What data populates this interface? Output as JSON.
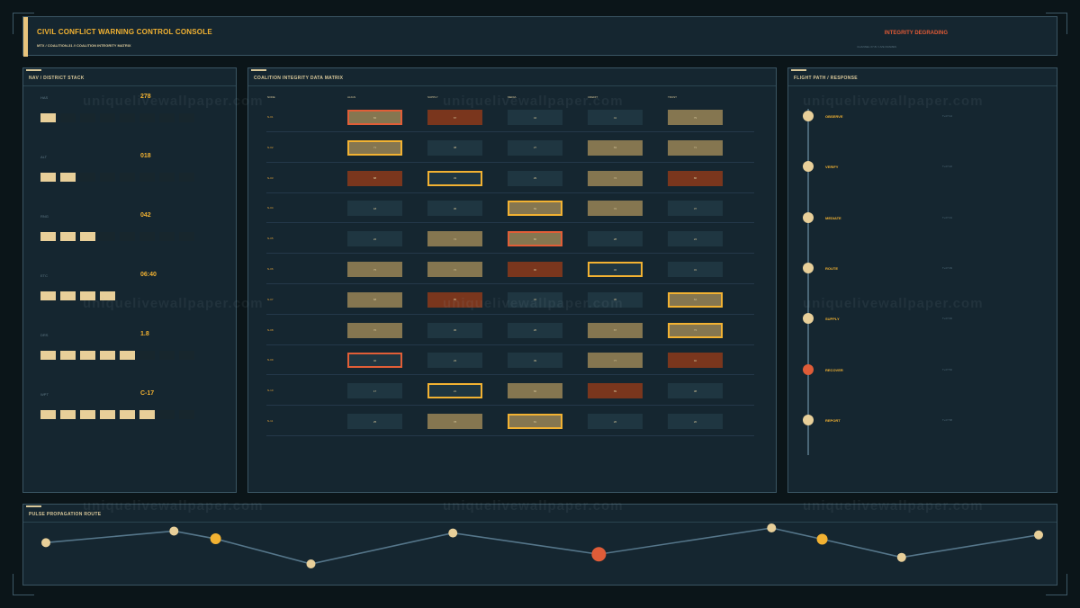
{
  "header": {
    "title": "CIVIL CONFLICT WARNING CONTROL CONSOLE",
    "breadcrumb": "MTX / COALITION-31 // COALITION INTEGRITY MATRIX",
    "status": "INTEGRITY DEGRADING",
    "status_sub": "CHANNEL 07-B / LIVE FRAMES",
    "accent_color": "#f2b232",
    "alert_color": "#e05a36"
  },
  "nav": {
    "title": "NAV / DISTRICT STACK",
    "blocks": [
      {
        "label": "HAS",
        "value": "278",
        "level": 1,
        "segments": 8
      },
      {
        "label": "ALT",
        "value": "018",
        "level": 2,
        "segments": 8
      },
      {
        "label": "RNG",
        "value": "042",
        "level": 3,
        "segments": 8
      },
      {
        "label": "ETC",
        "value": "06:40",
        "level": 4,
        "segments": 4
      },
      {
        "label": "DRS",
        "value": "1.8",
        "level": 5,
        "segments": 8
      },
      {
        "label": "WPT",
        "value": "C-17",
        "level": 6,
        "segments": 8
      }
    ]
  },
  "matrix": {
    "title": "COALITION INTEGRITY DATA MATRIX",
    "columns": [
      "NODE",
      "ALIGN",
      "SUPPLY",
      "MEDIA",
      "CREDIT",
      "TRUST"
    ],
    "rows": [
      {
        "label": "N-01",
        "cells": [
          {
            "v": "82",
            "s": "tan",
            "f": "alert"
          },
          {
            "v": "67",
            "s": "red",
            "f": ""
          },
          {
            "v": "44",
            "s": "base",
            "f": ""
          },
          {
            "v": "41",
            "s": "base",
            "f": ""
          },
          {
            "v": "79",
            "s": "tan",
            "f": ""
          }
        ]
      },
      {
        "label": "N-02",
        "cells": [
          {
            "v": "71",
            "s": "tan",
            "f": "warn"
          },
          {
            "v": "38",
            "s": "base",
            "f": ""
          },
          {
            "v": "27",
            "s": "base",
            "f": ""
          },
          {
            "v": "63",
            "s": "tan",
            "f": ""
          },
          {
            "v": "71",
            "s": "tan",
            "f": ""
          }
        ]
      },
      {
        "label": "N-03",
        "cells": [
          {
            "v": "88",
            "s": "red",
            "f": ""
          },
          {
            "v": "33",
            "s": "base",
            "f": "warn"
          },
          {
            "v": "29",
            "s": "base",
            "f": ""
          },
          {
            "v": "74",
            "s": "tan",
            "f": ""
          },
          {
            "v": "86",
            "s": "red",
            "f": ""
          }
        ]
      },
      {
        "label": "N-04",
        "cells": [
          {
            "v": "18",
            "s": "base",
            "f": ""
          },
          {
            "v": "36",
            "s": "base",
            "f": ""
          },
          {
            "v": "69",
            "s": "tan",
            "f": "warn"
          },
          {
            "v": "72",
            "s": "tan",
            "f": ""
          },
          {
            "v": "37",
            "s": "base",
            "f": ""
          }
        ]
      },
      {
        "label": "N-05",
        "cells": [
          {
            "v": "22",
            "s": "base",
            "f": ""
          },
          {
            "v": "74",
            "s": "tan",
            "f": ""
          },
          {
            "v": "80",
            "s": "tan",
            "f": "alert"
          },
          {
            "v": "28",
            "s": "base",
            "f": ""
          },
          {
            "v": "24",
            "s": "base",
            "f": ""
          }
        ]
      },
      {
        "label": "N-06",
        "cells": [
          {
            "v": "75",
            "s": "tan",
            "f": ""
          },
          {
            "v": "72",
            "s": "tan",
            "f": ""
          },
          {
            "v": "90",
            "s": "red",
            "f": ""
          },
          {
            "v": "32",
            "s": "base",
            "f": "warn"
          },
          {
            "v": "31",
            "s": "base",
            "f": ""
          }
        ]
      },
      {
        "label": "N-07",
        "cells": [
          {
            "v": "68",
            "s": "tan",
            "f": ""
          },
          {
            "v": "85",
            "s": "red",
            "f": ""
          },
          {
            "v": "34",
            "s": "base",
            "f": ""
          },
          {
            "v": "35",
            "s": "base",
            "f": ""
          },
          {
            "v": "64",
            "s": "tan",
            "f": "warn"
          }
        ]
      },
      {
        "label": "N-08",
        "cells": [
          {
            "v": "70",
            "s": "tan",
            "f": ""
          },
          {
            "v": "30",
            "s": "base",
            "f": ""
          },
          {
            "v": "26",
            "s": "base",
            "f": ""
          },
          {
            "v": "67",
            "s": "tan",
            "f": ""
          },
          {
            "v": "73",
            "s": "tan",
            "f": "warn"
          }
        ]
      },
      {
        "label": "N-09",
        "cells": [
          {
            "v": "40",
            "s": "base",
            "f": "alert"
          },
          {
            "v": "23",
            "s": "base",
            "f": ""
          },
          {
            "v": "39",
            "s": "base",
            "f": ""
          },
          {
            "v": "77",
            "s": "tan",
            "f": ""
          },
          {
            "v": "92",
            "s": "red",
            "f": ""
          }
        ]
      },
      {
        "label": "N-10",
        "cells": [
          {
            "v": "17",
            "s": "base",
            "f": ""
          },
          {
            "v": "21",
            "s": "base",
            "f": "warn"
          },
          {
            "v": "66",
            "s": "tan",
            "f": ""
          },
          {
            "v": "89",
            "s": "red",
            "f": ""
          },
          {
            "v": "38",
            "s": "base",
            "f": ""
          }
        ]
      },
      {
        "label": "N-11",
        "cells": [
          {
            "v": "25",
            "s": "base",
            "f": ""
          },
          {
            "v": "78",
            "s": "tan",
            "f": ""
          },
          {
            "v": "81",
            "s": "tan",
            "f": "warn"
          },
          {
            "v": "26",
            "s": "base",
            "f": ""
          },
          {
            "v": "20",
            "s": "base",
            "f": ""
          }
        ]
      }
    ]
  },
  "flight": {
    "title": "FLIGHT PATH / RESPONSE",
    "steps": [
      {
        "label": "OBSERVE",
        "time": "T+07:14",
        "alert": false
      },
      {
        "label": "VERIFY",
        "time": "T+07:22",
        "alert": false
      },
      {
        "label": "MEDIATE",
        "time": "T+07:31",
        "alert": false
      },
      {
        "label": "ROUTE",
        "time": "T+07:39",
        "alert": false
      },
      {
        "label": "SUPPLY",
        "time": "T+07:46",
        "alert": false
      },
      {
        "label": "RECOVER",
        "time": "T+07:52",
        "alert": true
      },
      {
        "label": "REPORT",
        "time": "T+07:58",
        "alert": false
      }
    ]
  },
  "route": {
    "title": "PULSE PROPAGATION ROUTE",
    "points": [
      {
        "x": 0,
        "y": 0.55,
        "kind": "normal"
      },
      {
        "x": 0.129,
        "y": 0.85,
        "kind": "normal"
      },
      {
        "x": 0.171,
        "y": 0.65,
        "kind": "warn"
      },
      {
        "x": 0.267,
        "y": 0.0,
        "kind": "normal"
      },
      {
        "x": 0.41,
        "y": 0.8,
        "kind": "normal"
      },
      {
        "x": 0.557,
        "y": 0.25,
        "kind": "alert"
      },
      {
        "x": 0.731,
        "y": 0.93,
        "kind": "normal"
      },
      {
        "x": 0.782,
        "y": 0.64,
        "kind": "warn"
      },
      {
        "x": 0.862,
        "y": 0.17,
        "kind": "normal"
      },
      {
        "x": 1.0,
        "y": 0.75,
        "kind": "normal"
      }
    ]
  },
  "watermark": "uniquelivewallpaper.com"
}
